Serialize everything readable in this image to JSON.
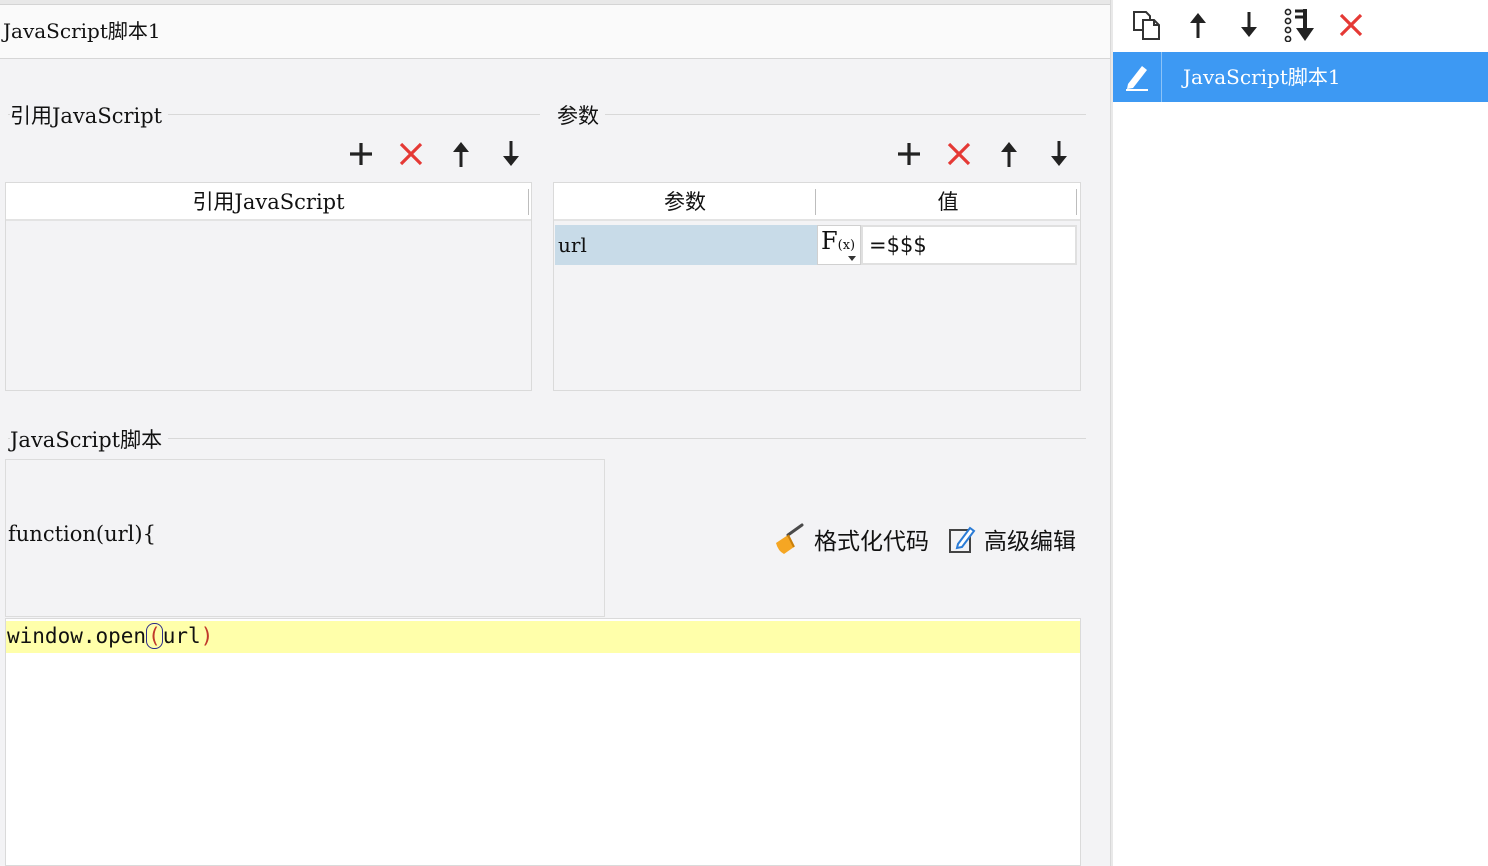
{
  "script_name": "JavaScript脚本1",
  "import_section": {
    "title": "引用JavaScript",
    "column_header": "引用JavaScript"
  },
  "params_section": {
    "title": "参数",
    "columns": [
      "参数",
      "值"
    ],
    "rows": [
      {
        "name": "url",
        "fx_label": "F",
        "fx_sub": "(x)",
        "value": "=$$$"
      }
    ]
  },
  "script_section": {
    "title": "JavaScript脚本",
    "function_signature": "function(url){",
    "format_code_label": "格式化代码",
    "advanced_edit_label": "高级编辑",
    "code": {
      "before": "window.open",
      "open_paren": "(",
      "arg": "url",
      "close_paren": ")"
    }
  },
  "right_panel": {
    "items": [
      {
        "label": "JavaScript脚本1",
        "selected": true
      }
    ]
  },
  "icons": {
    "add": "plus-icon",
    "delete": "x-icon",
    "up": "arrow-up-icon",
    "down": "arrow-down-icon",
    "copy": "copy-icon",
    "move_bottom": "move-to-bottom-icon",
    "edit": "pencil-icon",
    "broom": "broom-icon",
    "advanced": "edit-box-icon"
  },
  "colors": {
    "accent": "#3d99f3",
    "delete_red": "#e53935",
    "highlight_line": "#ffffaa",
    "selected_row": "#c8dbe8"
  }
}
